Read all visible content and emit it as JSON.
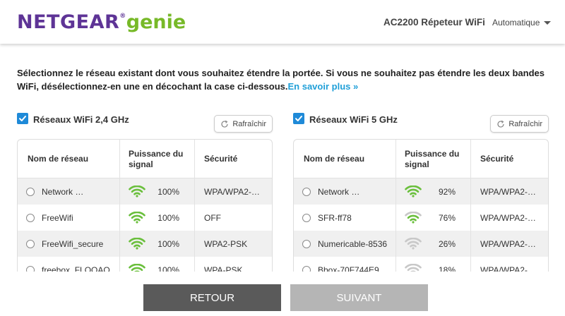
{
  "header": {
    "logo_netgear": "NETGEAR",
    "logo_reg": "®",
    "logo_genie": "genie",
    "product": "AC2200 Répeteur WiFi",
    "language": "Automatique"
  },
  "intro": {
    "text": "Sélectionnez le réseau existant dont vous souhaitez étendre la portée. Si vous ne souhaitez pas étendre les deux bandes WiFi, désélectionnez-en une en décochant la case ci-dessous.",
    "link": "En savoir plus »"
  },
  "columns": {
    "name": "Nom de réseau",
    "signal": "Puissance du signal",
    "security": "Sécurité"
  },
  "band24": {
    "title": "Réseaux WiFi 2,4 GHz",
    "checked": true,
    "refresh": "Rafraîchir",
    "networks": [
      {
        "name": "Network …",
        "signal": "100%",
        "level": 1.0,
        "security": "WPA/WPA2-…"
      },
      {
        "name": "FreeWifi",
        "signal": "100%",
        "level": 1.0,
        "security": "OFF"
      },
      {
        "name": "FreeWifi_secure",
        "signal": "100%",
        "level": 1.0,
        "security": "WPA2-PSK"
      },
      {
        "name": "freebox_FLOQAQ",
        "signal": "100%",
        "level": 1.0,
        "security": "WPA-PSK"
      }
    ]
  },
  "band5": {
    "title": "Réseaux WiFi 5 GHz",
    "checked": true,
    "refresh": "Rafraîchir",
    "networks": [
      {
        "name": "Network …",
        "signal": "92%",
        "level": 0.92,
        "security": "WPA/WPA2-…"
      },
      {
        "name": "SFR-ff78",
        "signal": "76%",
        "level": 0.76,
        "security": "WPA/WPA2-…"
      },
      {
        "name": "Numericable-8536",
        "signal": "26%",
        "level": 0.26,
        "security": "WPA/WPA2-…"
      },
      {
        "name": "Bbox-70F744E9",
        "signal": "18%",
        "level": 0.18,
        "security": "WPA/WPA2-…"
      }
    ]
  },
  "buttons": {
    "back": "RETOUR",
    "next": "SUIVANT"
  },
  "colors": {
    "brand_purple": "#5e3496",
    "brand_green": "#77b928",
    "link_blue": "#1f9fd8",
    "signal_green": "#6abf3c",
    "signal_weak": "#c8c8c8"
  }
}
